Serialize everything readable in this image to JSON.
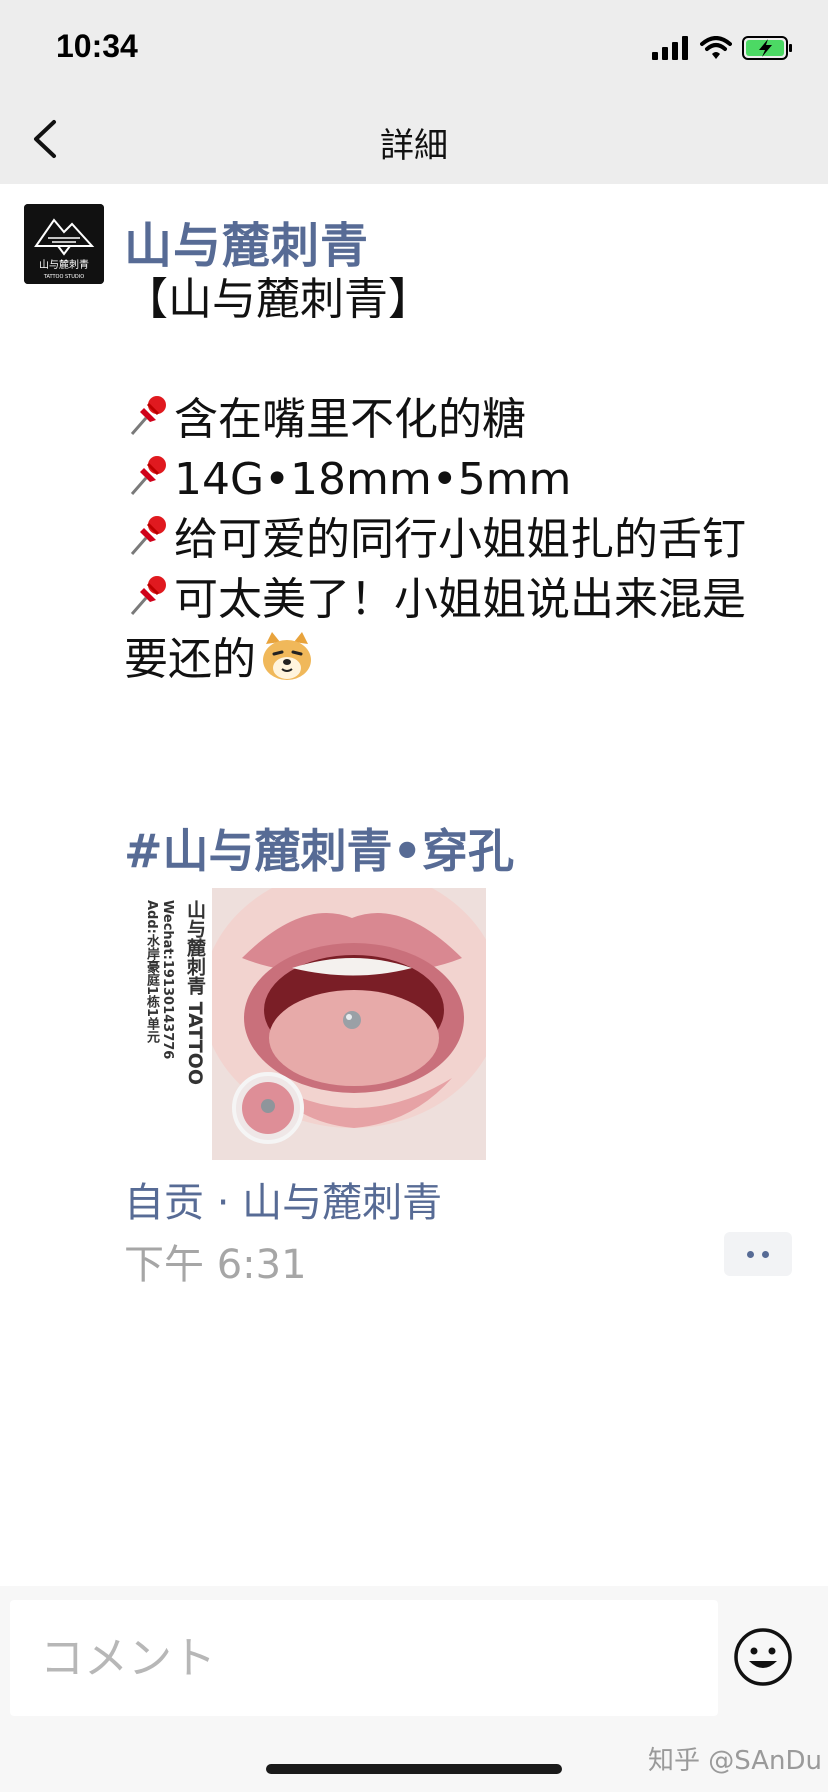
{
  "status_bar": {
    "time": "10:34",
    "battery_charging": true
  },
  "nav": {
    "title": "詳細",
    "back_icon": "chevron-left-icon"
  },
  "post": {
    "author": "山与麓刺青",
    "avatar_text": "山与麓刺青",
    "avatar_subtext": "TATTOO STUDIO",
    "lines": [
      {
        "pin": false,
        "text": "【山与麓刺青】"
      },
      {
        "pin": false,
        "text": ""
      },
      {
        "pin": true,
        "text": "含在嘴里不化的糖"
      },
      {
        "pin": true,
        "text": "14G•18mm•5mm"
      },
      {
        "pin": true,
        "text": "给可爱的同行小姐姐扎的舌钉"
      },
      {
        "pin": true,
        "text": "可太美了！小姐姐说出来混是要还的"
      }
    ],
    "emoji_icon": "doge-emoji-icon",
    "hashtag": "#山与麓刺青•穿孔",
    "image": {
      "caption_title": "山与麓刺青 TATTOO",
      "caption_wechat": "Wechat:19130143776",
      "caption_address": "Add:水岸豪庭1栋1单元"
    },
    "location": "自贡 · 山与麓刺青",
    "time": "下午 6:31"
  },
  "comment": {
    "placeholder": "コメント",
    "emoji_button_icon": "smiley-icon"
  },
  "watermark": "知乎 @SAnDu",
  "colors": {
    "link": "#576b95",
    "nav_bg": "#ededed",
    "time_gray": "#a6a6a6"
  }
}
